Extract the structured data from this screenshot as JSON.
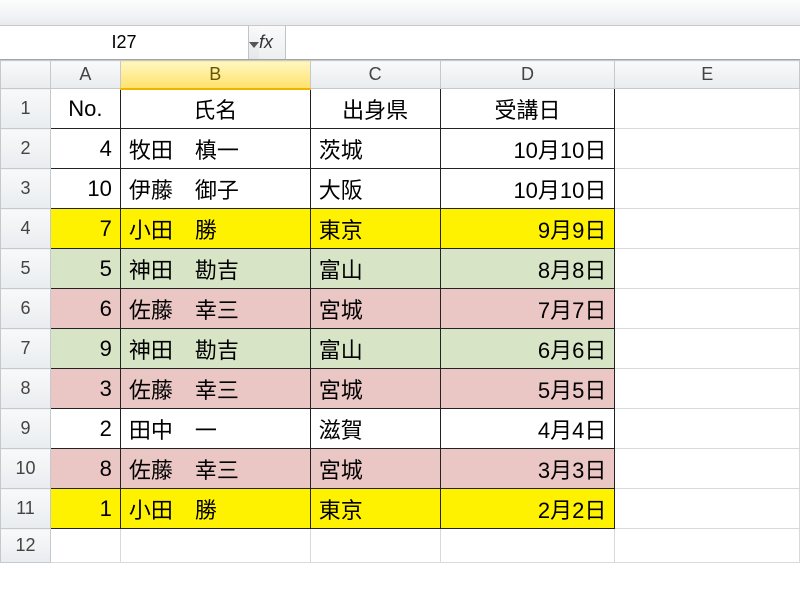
{
  "namebox": {
    "value": "I27"
  },
  "formula": {
    "fx_label": "fx",
    "value": ""
  },
  "columns": [
    "A",
    "B",
    "C",
    "D",
    "E"
  ],
  "selected_column": "B",
  "row_numbers": [
    "1",
    "2",
    "3",
    "4",
    "5",
    "6",
    "7",
    "8",
    "9",
    "10",
    "11",
    "12"
  ],
  "headers": {
    "a": "No.",
    "b": "氏名",
    "c": "出身県",
    "d": "受講日"
  },
  "rows": [
    {
      "no": "4",
      "name": "牧田　槙一",
      "pref": "茨城",
      "date": "10月10日",
      "fill": "white"
    },
    {
      "no": "10",
      "name": "伊藤　御子",
      "pref": "大阪",
      "date": "10月10日",
      "fill": "white"
    },
    {
      "no": "7",
      "name": "小田　勝",
      "pref": "東京",
      "date": "9月9日",
      "fill": "yellow"
    },
    {
      "no": "5",
      "name": "神田　勘吉",
      "pref": "富山",
      "date": "8月8日",
      "fill": "green"
    },
    {
      "no": "6",
      "name": "佐藤　幸三",
      "pref": "宮城",
      "date": "7月7日",
      "fill": "pink"
    },
    {
      "no": "9",
      "name": "神田　勘吉",
      "pref": "富山",
      "date": "6月6日",
      "fill": "green"
    },
    {
      "no": "3",
      "name": "佐藤　幸三",
      "pref": "宮城",
      "date": "5月5日",
      "fill": "pink"
    },
    {
      "no": "2",
      "name": "田中　一",
      "pref": "滋賀",
      "date": "4月4日",
      "fill": "white"
    },
    {
      "no": "8",
      "name": "佐藤　幸三",
      "pref": "宮城",
      "date": "3月3日",
      "fill": "pink"
    },
    {
      "no": "1",
      "name": "小田　勝",
      "pref": "東京",
      "date": "2月2日",
      "fill": "yellow"
    }
  ]
}
